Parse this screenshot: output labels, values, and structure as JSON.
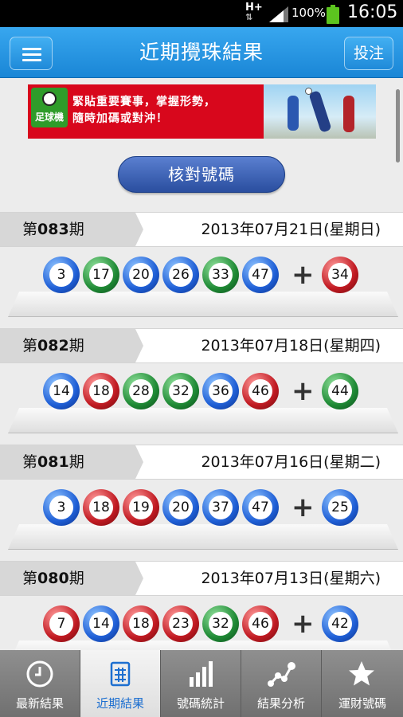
{
  "statusbar": {
    "network": "H+",
    "battery_pct": "100%",
    "time": "16:05"
  },
  "header": {
    "title": "近期攪珠結果",
    "bet_label": "投注"
  },
  "banner": {
    "logo_text": "足球機",
    "line1": "緊貼重要賽事，掌握形勢，",
    "line2": "隨時加碼或對沖！"
  },
  "check_button": "核對號碼",
  "draws": [
    {
      "prefix": "第",
      "num": "083",
      "suffix": "期",
      "date": "2013年07月21日(星期日)",
      "balls": [
        {
          "n": "3",
          "c": "blue"
        },
        {
          "n": "17",
          "c": "green"
        },
        {
          "n": "20",
          "c": "blue"
        },
        {
          "n": "26",
          "c": "blue"
        },
        {
          "n": "33",
          "c": "green"
        },
        {
          "n": "47",
          "c": "blue"
        }
      ],
      "extra": {
        "n": "34",
        "c": "red"
      }
    },
    {
      "prefix": "第",
      "num": "082",
      "suffix": "期",
      "date": "2013年07月18日(星期四)",
      "balls": [
        {
          "n": "14",
          "c": "blue"
        },
        {
          "n": "18",
          "c": "red"
        },
        {
          "n": "28",
          "c": "green"
        },
        {
          "n": "32",
          "c": "green"
        },
        {
          "n": "36",
          "c": "blue"
        },
        {
          "n": "46",
          "c": "red"
        }
      ],
      "extra": {
        "n": "44",
        "c": "green"
      }
    },
    {
      "prefix": "第",
      "num": "081",
      "suffix": "期",
      "date": "2013年07月16日(星期二)",
      "balls": [
        {
          "n": "3",
          "c": "blue"
        },
        {
          "n": "18",
          "c": "red"
        },
        {
          "n": "19",
          "c": "red"
        },
        {
          "n": "20",
          "c": "blue"
        },
        {
          "n": "37",
          "c": "blue"
        },
        {
          "n": "47",
          "c": "blue"
        }
      ],
      "extra": {
        "n": "25",
        "c": "blue"
      }
    },
    {
      "prefix": "第",
      "num": "080",
      "suffix": "期",
      "date": "2013年07月13日(星期六)",
      "balls": [
        {
          "n": "7",
          "c": "red"
        },
        {
          "n": "14",
          "c": "blue"
        },
        {
          "n": "18",
          "c": "red"
        },
        {
          "n": "23",
          "c": "red"
        },
        {
          "n": "32",
          "c": "green"
        },
        {
          "n": "46",
          "c": "red"
        }
      ],
      "extra": {
        "n": "42",
        "c": "blue"
      }
    }
  ],
  "plus_sign": "+",
  "nav": [
    {
      "label": "最新結果",
      "icon": "clock-icon",
      "active": false
    },
    {
      "label": "近期結果",
      "icon": "calendar-icon",
      "active": true
    },
    {
      "label": "號碼統計",
      "icon": "bar-chart-icon",
      "active": false
    },
    {
      "label": "結果分析",
      "icon": "line-chart-icon",
      "active": false
    },
    {
      "label": "運財號碼",
      "icon": "star-icon",
      "active": false
    }
  ],
  "colors": {
    "header": "#1f8ad9",
    "ball_blue": "#1f5fd6",
    "ball_green": "#1f8a35",
    "ball_red": "#c11a22",
    "nav_active": "#1d6fd0"
  }
}
